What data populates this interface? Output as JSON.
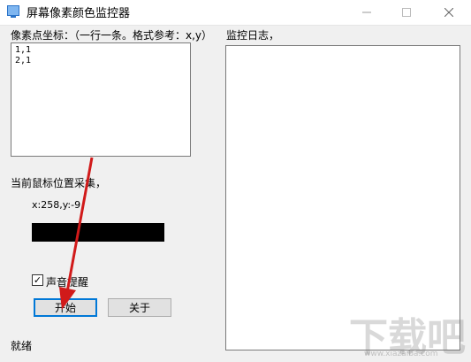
{
  "window": {
    "title": "屏幕像素颜色监控器",
    "minimize_icon": "minimize-icon",
    "maximize_icon": "maximize-icon",
    "close_icon": "close-icon"
  },
  "coords": {
    "label": "像素点坐标：（一行一条。格式参考：x,y）",
    "lines": [
      "1,1",
      "2,1"
    ]
  },
  "log": {
    "label": "监控日志，"
  },
  "capture": {
    "label": "当前鼠标位置采集，",
    "position_text": "x:258,y:-9",
    "swatch_color": "#000000"
  },
  "sound": {
    "label": "声音提醒",
    "checked": true
  },
  "buttons": {
    "start": "开始",
    "about": "关于"
  },
  "status": {
    "text": "就绪"
  },
  "overlay": {
    "arrow_color": "#d11a1a",
    "watermark": "下载吧",
    "watermark_sub": "www.xiazaiba.com"
  }
}
